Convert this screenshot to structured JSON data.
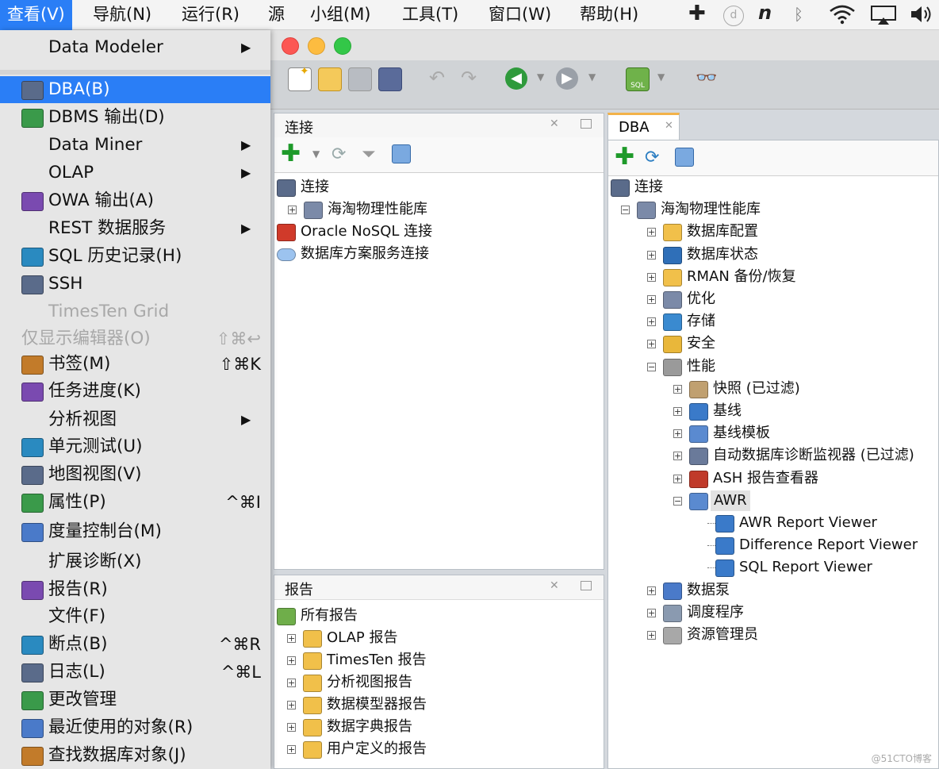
{
  "menubar": {
    "items": [
      "查看(V)",
      "导航(N)",
      "运行(R)",
      "源",
      "小组(M)",
      "工具(T)",
      "窗口(W)",
      "帮助(H)"
    ]
  },
  "view_menu": {
    "top_item": "Data Modeler",
    "items": [
      {
        "label": "DBA(B)",
        "icon": "dba-icon",
        "selected": true
      },
      {
        "label": "DBMS 输出(D)",
        "icon": "dbms-output-icon"
      },
      {
        "label": "Data Miner",
        "submenu": true
      },
      {
        "label": "OLAP",
        "submenu": true
      },
      {
        "label": "OWA 输出(A)",
        "icon": "owa-output-icon"
      },
      {
        "label": "REST 数据服务",
        "submenu": true
      },
      {
        "label": "SQL 历史记录(H)",
        "icon": "sql-history-icon"
      },
      {
        "label": "SSH",
        "icon": "ssh-icon"
      },
      {
        "label": "TimesTen Grid",
        "disabled": true
      },
      {
        "label": "仅显示编辑器(O)",
        "disabled": true,
        "shortcut": "⇧⌘↩"
      },
      {
        "label": "书签(M)",
        "icon": "bookmark-icon",
        "shortcut": "⇧⌘K"
      },
      {
        "label": "任务进度(K)",
        "icon": "task-progress-icon"
      },
      {
        "label": "分析视图",
        "submenu": true
      },
      {
        "label": "单元测试(U)",
        "icon": "unit-test-icon"
      },
      {
        "label": "地图视图(V)",
        "icon": "map-view-icon"
      },
      {
        "label": "属性(P)",
        "icon": "properties-icon",
        "shortcut": "^⌘I"
      },
      {
        "label": "度量控制台(M)",
        "icon": "metrics-console-icon"
      },
      {
        "label": "扩展诊断(X)"
      },
      {
        "label": "报告(R)",
        "icon": "reports-icon"
      },
      {
        "label": "文件(F)"
      },
      {
        "label": "断点(B)",
        "icon": "breakpoints-icon",
        "shortcut": "^⌘R"
      },
      {
        "label": "日志(L)",
        "icon": "log-icon",
        "shortcut": "^⌘L"
      },
      {
        "label": "更改管理",
        "icon": "change-management-icon"
      },
      {
        "label": "最近使用的对象(R)",
        "icon": "recent-objects-icon"
      },
      {
        "label": "查找数据库对象(J)",
        "icon": "find-db-object-icon"
      }
    ]
  },
  "connections_panel": {
    "title": "连接",
    "tree": [
      {
        "label": "连接",
        "level": 0,
        "icon": "connections-icon"
      },
      {
        "label": "海淘物理性能库",
        "level": 1,
        "icon": "database-icon",
        "expander": "+"
      },
      {
        "label": "Oracle NoSQL 连接",
        "level": 0,
        "icon": "nosql-icon"
      },
      {
        "label": "数据库方案服务连接",
        "level": 0,
        "icon": "cloud-icon"
      }
    ]
  },
  "reports_panel": {
    "title": "报告",
    "tree": [
      {
        "label": "所有报告",
        "level": 0,
        "icon": "all-reports-icon"
      },
      {
        "label": "OLAP 报告",
        "level": 1,
        "icon": "folder-icon",
        "expander": "+"
      },
      {
        "label": "TimesTen 报告",
        "level": 1,
        "icon": "folder-icon",
        "expander": "+"
      },
      {
        "label": "分析视图报告",
        "level": 1,
        "icon": "folder-icon",
        "expander": "+"
      },
      {
        "label": "数据模型器报告",
        "level": 1,
        "icon": "folder-icon",
        "expander": "+"
      },
      {
        "label": "数据字典报告",
        "level": 1,
        "icon": "folder-icon",
        "expander": "+"
      },
      {
        "label": "用户定义的报告",
        "level": 1,
        "icon": "folder-icon",
        "expander": "+"
      }
    ]
  },
  "dba_panel": {
    "tab": "DBA",
    "tree": [
      {
        "label": "连接",
        "level": 0,
        "icon": "connections-icon"
      },
      {
        "label": "海淘物理性能库",
        "level": 1,
        "icon": "database-icon",
        "expander": "-"
      },
      {
        "label": "数据库配置",
        "level": 2,
        "icon": "folder-config-icon",
        "expander": "+"
      },
      {
        "label": "数据库状态",
        "level": 2,
        "icon": "folder-status-icon",
        "expander": "+"
      },
      {
        "label": "RMAN 备份/恢复",
        "level": 2,
        "icon": "folder-rman-icon",
        "expander": "+"
      },
      {
        "label": "优化",
        "level": 2,
        "icon": "tuning-icon",
        "expander": "+"
      },
      {
        "label": "存储",
        "level": 2,
        "icon": "storage-icon",
        "expander": "+"
      },
      {
        "label": "安全",
        "level": 2,
        "icon": "security-icon",
        "expander": "+"
      },
      {
        "label": "性能",
        "level": 2,
        "icon": "performance-icon",
        "expander": "-"
      },
      {
        "label": "快照 (已过滤)",
        "level": 3,
        "icon": "snapshot-icon",
        "expander": "+"
      },
      {
        "label": "基线",
        "level": 3,
        "icon": "baseline-icon",
        "expander": "+"
      },
      {
        "label": "基线模板",
        "level": 3,
        "icon": "baseline-template-icon",
        "expander": "+"
      },
      {
        "label": "自动数据库诊断监视器 (已过滤)",
        "level": 3,
        "icon": "addm-icon",
        "expander": "+"
      },
      {
        "label": "ASH 报告查看器",
        "level": 3,
        "icon": "ash-report-icon",
        "expander": "+"
      },
      {
        "label": "AWR",
        "level": 3,
        "icon": "awr-folder-icon",
        "expander": "-",
        "selected": true
      },
      {
        "label": "AWR Report Viewer",
        "level": 4,
        "icon": "report-viewer-icon"
      },
      {
        "label": "Difference Report Viewer",
        "level": 4,
        "icon": "report-viewer-icon"
      },
      {
        "label": "SQL Report Viewer",
        "level": 4,
        "icon": "report-viewer-icon"
      },
      {
        "label": "数据泵",
        "level": 2,
        "icon": "data-pump-icon",
        "expander": "+"
      },
      {
        "label": "调度程序",
        "level": 2,
        "icon": "scheduler-icon",
        "expander": "+"
      },
      {
        "label": "资源管理员",
        "level": 2,
        "icon": "resource-manager-icon",
        "expander": "+"
      }
    ]
  },
  "watermark": "@51CTO博客",
  "colors": {
    "accent": "#2a7ef6",
    "tab_highlight": "#f2b24a"
  }
}
